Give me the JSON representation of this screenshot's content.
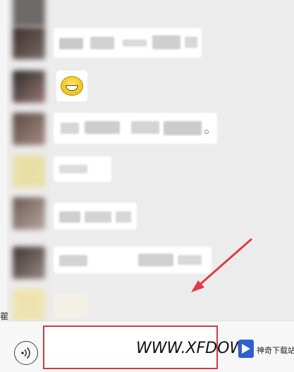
{
  "watermark": {
    "text": "WWW.XFDOW",
    "brand": "神奇下载站"
  },
  "side_glyph": "瞿",
  "emoji": {
    "icon": "grinning-face-icon"
  },
  "colors": {
    "highlight": "#d23a48",
    "arrow": "#e13a46",
    "logo": "#2f5fd0"
  }
}
